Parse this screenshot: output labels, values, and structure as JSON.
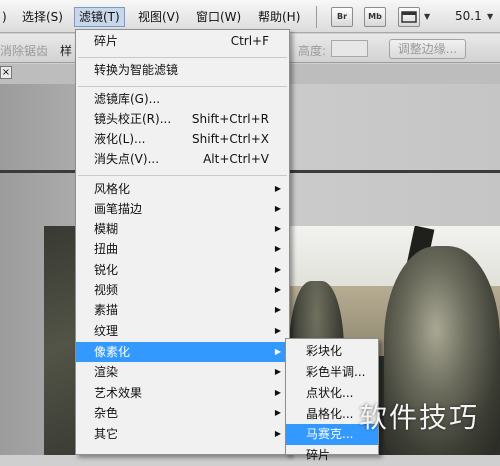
{
  "menubar": {
    "items": [
      {
        "label": ")"
      },
      {
        "label": "选择(S)"
      },
      {
        "label": "滤镜(T)",
        "active": true
      },
      {
        "label": "视图(V)"
      },
      {
        "label": "窗口(W)"
      },
      {
        "label": "帮助(H)"
      }
    ],
    "buttons": [
      {
        "icon": "bridge-icon",
        "label": "Br"
      },
      {
        "icon": "minibridge-icon",
        "label": "Mb"
      },
      {
        "icon": "screen-mode-icon",
        "label": ""
      }
    ],
    "zoom": "50.1"
  },
  "optionsbar": {
    "left_label": "消除锯齿",
    "style_label": "样",
    "height_label": "高度:",
    "height_value": "",
    "refine_edge": "调整边缘..."
  },
  "filter_menu": {
    "sections": [
      [
        {
          "label": "碎片",
          "shortcut": "Ctrl+F"
        }
      ],
      [
        {
          "label": "转换为智能滤镜"
        }
      ],
      [
        {
          "label": "滤镜库(G)..."
        },
        {
          "label": "镜头校正(R)...",
          "shortcut": "Shift+Ctrl+R"
        },
        {
          "label": "液化(L)...",
          "shortcut": "Shift+Ctrl+X"
        },
        {
          "label": "消失点(V)...",
          "shortcut": "Alt+Ctrl+V"
        }
      ],
      [
        {
          "label": "风格化",
          "submenu": true
        },
        {
          "label": "画笔描边",
          "submenu": true
        },
        {
          "label": "模糊",
          "submenu": true
        },
        {
          "label": "扭曲",
          "submenu": true
        },
        {
          "label": "锐化",
          "submenu": true
        },
        {
          "label": "视频",
          "submenu": true
        },
        {
          "label": "素描",
          "submenu": true
        },
        {
          "label": "纹理",
          "submenu": true
        },
        {
          "label": "像素化",
          "submenu": true,
          "highlighted": true
        },
        {
          "label": "渲染",
          "submenu": true
        },
        {
          "label": "艺术效果",
          "submenu": true
        },
        {
          "label": "杂色",
          "submenu": true
        },
        {
          "label": "其它",
          "submenu": true
        }
      ]
    ]
  },
  "pixelate_submenu": {
    "items": [
      {
        "label": "彩块化"
      },
      {
        "label": "彩色半调..."
      },
      {
        "label": "点状化..."
      },
      {
        "label": "晶格化..."
      },
      {
        "label": "马赛克...",
        "highlighted": true
      },
      {
        "label": "碎片"
      }
    ]
  },
  "document": {
    "close_glyph": "×"
  },
  "watermark": "软件技巧",
  "colors": {
    "highlight": "#3399ff",
    "menu_bg": "#f1f1f1"
  }
}
